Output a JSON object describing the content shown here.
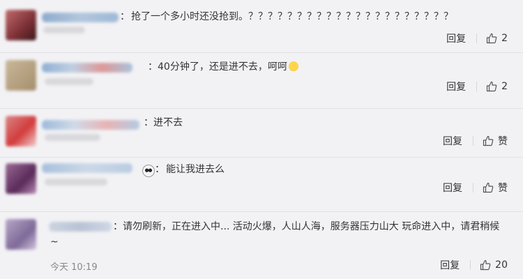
{
  "comments": [
    {
      "separator": "：",
      "text": "抢了一个多小时还没抢到。？？？？？？？？？？？？？？？？？？？？？",
      "reply_label": "回复",
      "like_label": "2"
    },
    {
      "separator": "：",
      "text": "40分钟了，还是进不去，呵呵",
      "emoji": "smile-emoji",
      "reply_label": "回复",
      "like_label": "2"
    },
    {
      "separator": "：",
      "text": "进不去",
      "reply_label": "回复",
      "like_label": "赞"
    },
    {
      "separator": "：",
      "emoji_before": "panda-emoji",
      "text": "能让我进去么",
      "reply_label": "回复",
      "like_label": "赞"
    },
    {
      "separator": "：",
      "text": "请勿刷新，正在进入中... 活动火爆，人山人海，服务器压力山大 玩命进入中，请君稍候~",
      "timestamp": "今天 10:19",
      "reply_label": "回复",
      "like_label": "20"
    }
  ],
  "colors": {
    "background": "#f2f2f5",
    "divider": "#e2e2e6",
    "text": "#333333",
    "muted": "#888888"
  }
}
